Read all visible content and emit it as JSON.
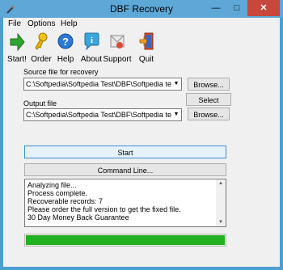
{
  "window": {
    "title": "DBF Recovery"
  },
  "menu": {
    "file": "File",
    "options": "Options",
    "help": "Help"
  },
  "toolbar": {
    "start": "Start!",
    "order": "Order",
    "help": "Help",
    "about": "About",
    "support": "Support",
    "quit": "Quit"
  },
  "source": {
    "label": "Source file for recovery",
    "value": "C:\\Softpedia\\Softpedia Test\\DBF\\Softpedia test.dl",
    "browse": "Browse..."
  },
  "select_folder": "Select folder...",
  "output": {
    "label": "Output file",
    "value": "C:\\Softpedia\\Softpedia Test\\DBF\\Softpedia test.dl",
    "browse": "Browse..."
  },
  "actions": {
    "start": "Start",
    "command_line": "Command Line..."
  },
  "log": {
    "lines": [
      "Analyzing file...",
      "Process complete.",
      "Recoverable records: 7",
      "Please order the full version to get the fixed file.",
      "30 Day Money Back Guarantee"
    ]
  },
  "progress": {
    "percent": 100,
    "color": "#23b121"
  }
}
